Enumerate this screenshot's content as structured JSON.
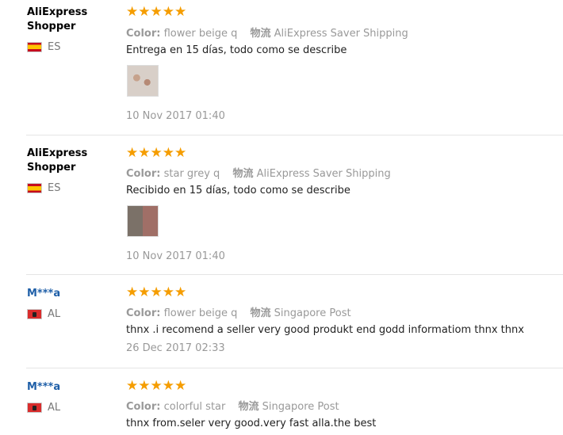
{
  "reviews": [
    {
      "user": "AliExpress Shopper",
      "country": "ES",
      "stars": "★★★★★",
      "color_label": "Color:",
      "color_value": "flower beige q",
      "shipping_label": "物流",
      "shipping_value": "AliExpress Saver Shipping",
      "text": "Entrega en 15 días, todo como se describe",
      "date": "10 Nov 2017 01:40"
    },
    {
      "user": "AliExpress Shopper",
      "country": "ES",
      "stars": "★★★★★",
      "color_label": "Color:",
      "color_value": "star grey q",
      "shipping_label": "物流",
      "shipping_value": "AliExpress Saver Shipping",
      "text": "Recibido en 15 días, todo como se describe",
      "date": "10 Nov 2017 01:40"
    },
    {
      "user": "M***a",
      "country": "AL",
      "stars": "★★★★★",
      "color_label": "Color:",
      "color_value": "flower beige q",
      "shipping_label": "物流",
      "shipping_value": "Singapore Post",
      "text": "thnx .i recomend a seller very good produkt end godd informatiom thnx thnx",
      "date": "26 Dec 2017 02:33"
    },
    {
      "user": "M***a",
      "country": "AL",
      "stars": "★★★★★",
      "color_label": "Color:",
      "color_value": "colorful star",
      "shipping_label": "物流",
      "shipping_value": "Singapore Post",
      "text": "thnx from.seler very good.very fast alla.the best"
    }
  ]
}
